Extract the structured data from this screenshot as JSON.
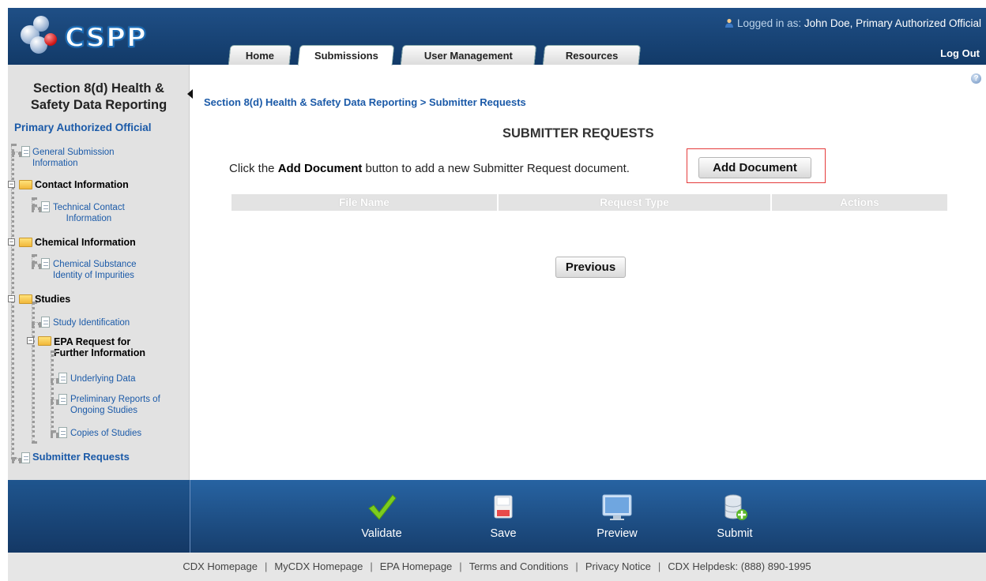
{
  "header": {
    "logo_text": "CSPP",
    "user_prefix": "Logged in as:",
    "user_name": "John Doe, Primary Authorized Official",
    "logout_label": "Log Out",
    "tabs": [
      {
        "label": "Home",
        "active": false
      },
      {
        "label": "Submissions",
        "active": true
      },
      {
        "label": "User Management",
        "active": false
      },
      {
        "label": "Resources",
        "active": false
      }
    ]
  },
  "sidebar": {
    "title_line1": "Section 8(d) Health &",
    "title_line2": "Safety Data Reporting",
    "role": "Primary Authorized Official",
    "items": [
      {
        "label_line1": "General Submission",
        "label_line2": "Information"
      },
      {
        "label": "Contact Information"
      },
      {
        "label_line1": "Technical Contact",
        "label_line2": "Information"
      },
      {
        "label": "Chemical Information"
      },
      {
        "label_line1": "Chemical Substance",
        "label_line2": "Identity of Impurities"
      },
      {
        "label": "Studies"
      },
      {
        "label": "Study Identification"
      },
      {
        "label_line1": "EPA Request for",
        "label_line2": "Further Information"
      },
      {
        "label": "Underlying Data"
      },
      {
        "label_line1": "Preliminary Reports of",
        "label_line2": "Ongoing Studies"
      },
      {
        "label": "Copies of Studies"
      },
      {
        "label": "Submitter Requests"
      }
    ]
  },
  "main": {
    "breadcrumb_parent": "Section 8(d) Health & Safety Data Reporting",
    "breadcrumb_sep": " > ",
    "breadcrumb_current": "Submitter Requests",
    "title": "SUBMITTER REQUESTS",
    "instructions_pre": "Click the ",
    "instructions_bold": "Add Document",
    "instructions_post": " button to add a new Submitter Request document.",
    "add_document_label": "Add Document",
    "table_headers": [
      "File Name",
      "Request Type",
      "Actions"
    ],
    "previous_label": "Previous"
  },
  "toolbar": {
    "validate_label": "Validate",
    "save_label": "Save",
    "preview_label": "Preview",
    "submit_label": "Submit"
  },
  "footer": {
    "links": [
      "CDX Homepage",
      "MyCDX Homepage",
      "EPA Homepage",
      "Terms and Conditions",
      "Privacy Notice",
      "CDX Helpdesk: (888) 890-1995"
    ]
  }
}
